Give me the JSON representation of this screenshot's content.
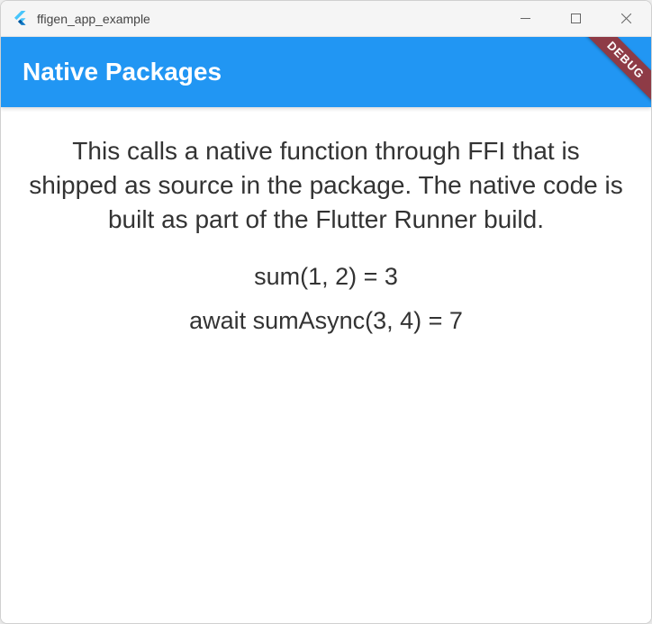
{
  "titlebar": {
    "title": "ffigen_app_example"
  },
  "appbar": {
    "title": "Native Packages",
    "debug_label": "DEBUG"
  },
  "content": {
    "description": "This calls a native function through FFI that is shipped as source in the package. The native code is built as part of the Flutter Runner build.",
    "sum_result": "sum(1, 2) = 3",
    "sum_async_result": "await sumAsync(3, 4) = 7"
  }
}
